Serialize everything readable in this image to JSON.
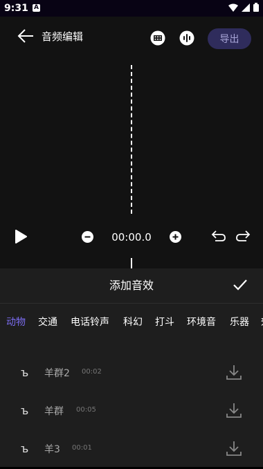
{
  "status": {
    "time": "9:31",
    "notification": "A"
  },
  "header": {
    "title": "音频编辑",
    "export_label": "导出"
  },
  "player": {
    "time": "00:00.0"
  },
  "panel": {
    "title": "添加音效",
    "tabs": [
      "动物",
      "交通",
      "电话铃声",
      "科幻",
      "打斗",
      "环境音",
      "乐器",
      "效"
    ],
    "active_tab": "动物",
    "items": [
      {
        "icon": "ъ",
        "name": "羊群2",
        "duration": "00:02"
      },
      {
        "icon": "ъ",
        "name": "羊群",
        "duration": "00:05"
      },
      {
        "icon": "ъ",
        "name": "羊3",
        "duration": "00:01"
      }
    ]
  },
  "colors": {
    "accent": "#7b6cf0",
    "export_bg": "#2f2c5c",
    "panel_bg": "#1e1e1e",
    "app_bg": "#121212"
  }
}
